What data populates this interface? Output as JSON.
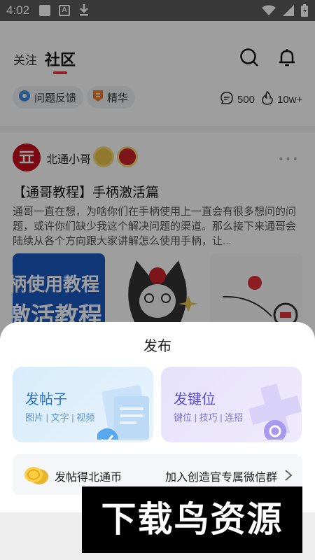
{
  "status_bar": {
    "time": "4:02",
    "notification_icons": [
      "square-icon",
      "a-box-icon",
      "download-icon"
    ],
    "right_icons": [
      "wifi-icon",
      "signal-icon",
      "battery-icon"
    ]
  },
  "header": {
    "tabs": [
      {
        "label": "关注",
        "active": false
      },
      {
        "label": "社区",
        "active": true
      }
    ],
    "actions": [
      "search-icon",
      "bell-icon"
    ],
    "pills": [
      {
        "label": "问题反馈",
        "icon": "gear-badge-icon"
      },
      {
        "label": "精华",
        "icon": "essence-badge-icon"
      }
    ],
    "stats": [
      {
        "value": "500",
        "icon": "comment-icon"
      },
      {
        "value": "10w+",
        "icon": "fire-icon"
      }
    ]
  },
  "post": {
    "author": "北通小哥",
    "title": "【通哥教程】手柄激活篇",
    "excerpt": "通哥一直在想，为啥你们在手柄使用上一直会有很多想问的问题，或许你们缺少我这个解决问题的渠道。那么接下来通哥会陆续从各个方向跟大家讲解怎么使用手柄，让...",
    "thumb_text_line1": "柄使用教程",
    "thumb_text_line2": "激活教程"
  },
  "sheet": {
    "title": "发布",
    "cards": [
      {
        "title": "发帖子",
        "subtitle": "图片 | 文字 | 视频",
        "icon": "document-check-icon"
      },
      {
        "title": "发键位",
        "subtitle": "键位 | 技巧 | 连招",
        "icon": "dpad-icon"
      }
    ],
    "coin_label": "发帖得北通币",
    "coin_link": "加入创造官专属微信群"
  },
  "watermark": "下载鸟资源",
  "colors": {
    "accent": "#e3313a",
    "post_card": "#2a73c9",
    "key_card": "#5a4fcf"
  }
}
